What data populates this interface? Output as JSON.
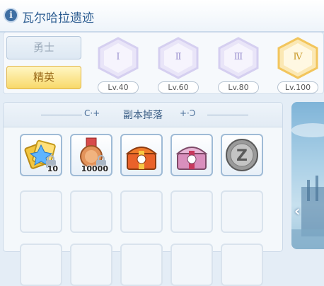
{
  "header": {
    "title": "瓦尔哈拉遗迹",
    "info_icon": "i"
  },
  "difficulty": {
    "brave_label": "勇士",
    "elite_label": "精英",
    "selected": "精英"
  },
  "levels": [
    {
      "numeral": "Ⅰ",
      "label": "Lv.40",
      "active": false
    },
    {
      "numeral": "Ⅱ",
      "label": "Lv.60",
      "active": false
    },
    {
      "numeral": "Ⅲ",
      "label": "Lv.80",
      "active": false
    },
    {
      "numeral": "Ⅳ",
      "label": "Lv.100",
      "active": true
    }
  ],
  "drops": {
    "title": "副本掉落",
    "left_deco": "C·+",
    "right_deco": "+·Ɔ",
    "items": [
      {
        "name": "gold-tickets-icon",
        "qty": "10",
        "locked": true
      },
      {
        "name": "medal-icon",
        "qty": "10000",
        "locked": true
      },
      {
        "name": "red-treasure-chest-icon",
        "qty": "",
        "locked": false
      },
      {
        "name": "pink-treasure-chest-icon",
        "qty": "",
        "locked": false
      },
      {
        "name": "zeny-coin-icon",
        "qty": "",
        "locked": false
      }
    ]
  },
  "scene": {
    "arrow": "‹"
  },
  "colors": {
    "title": "#2e5e92",
    "elite": "#f8d96a",
    "hex_inactive": "#d9d4f2",
    "hex_active": "#f2c55c"
  }
}
